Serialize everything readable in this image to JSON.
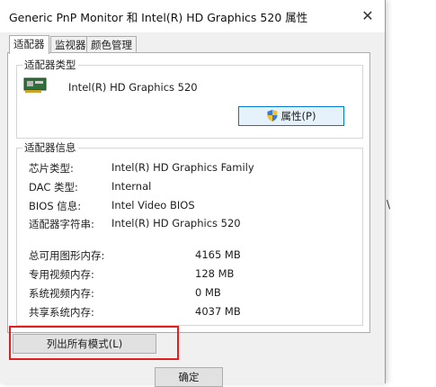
{
  "window": {
    "title": "Generic PnP Monitor 和 Intel(R) HD Graphics 520 属性",
    "close_glyph": "✕"
  },
  "tabs": [
    {
      "label": "适配器",
      "active": true
    },
    {
      "label": "监视器",
      "active": false
    },
    {
      "label": "颜色管理",
      "active": false
    }
  ],
  "adapter_type": {
    "group_label": "适配器类型",
    "name": "Intel(R) HD Graphics 520",
    "icon": "graphics-card-icon",
    "properties_button": "属性(P)"
  },
  "adapter_info": {
    "group_label": "适配器信息",
    "rows": [
      {
        "label": "芯片类型:",
        "value": "Intel(R) HD Graphics Family"
      },
      {
        "label": "DAC 类型:",
        "value": "Internal"
      },
      {
        "label": "BIOS 信息:",
        "value": "Intel Video BIOS"
      },
      {
        "label": "适配器字符串:",
        "value": "Intel(R) HD Graphics 520"
      }
    ],
    "memory": [
      {
        "label": "总可用图形内存:",
        "value": "4165 MB"
      },
      {
        "label": "专用视频内存:",
        "value": "128 MB"
      },
      {
        "label": "系统视频内存:",
        "value": "0 MB"
      },
      {
        "label": "共享系统内存:",
        "value": "4037 MB"
      }
    ]
  },
  "buttons": {
    "list_all_modes": "列出所有模式(L)",
    "ok": "确定"
  },
  "background": {
    "glyph": "\\"
  },
  "colors": {
    "highlight": "#e02020",
    "focus_border": "#0078d7"
  }
}
